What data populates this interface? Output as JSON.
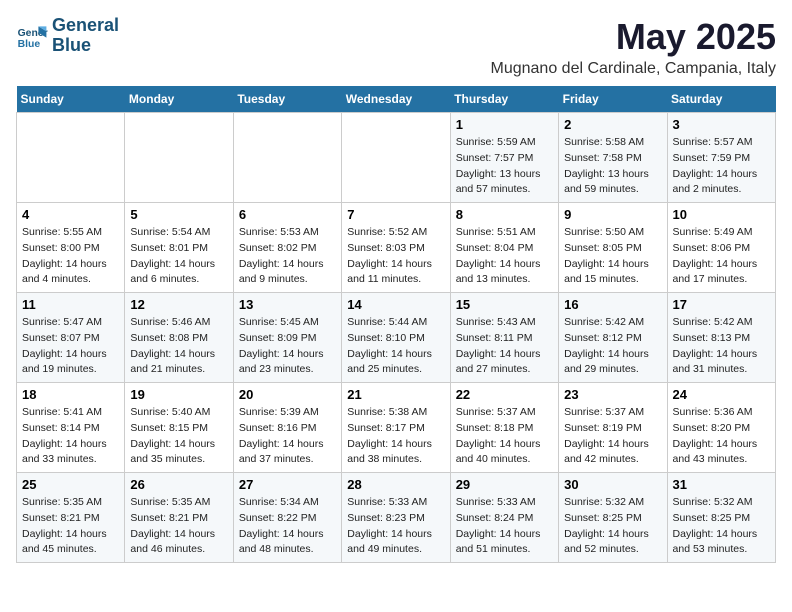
{
  "logo": {
    "line1": "General",
    "line2": "Blue"
  },
  "title": "May 2025",
  "subtitle": "Mugnano del Cardinale, Campania, Italy",
  "days_of_week": [
    "Sunday",
    "Monday",
    "Tuesday",
    "Wednesday",
    "Thursday",
    "Friday",
    "Saturday"
  ],
  "weeks": [
    [
      {
        "day": "",
        "info": ""
      },
      {
        "day": "",
        "info": ""
      },
      {
        "day": "",
        "info": ""
      },
      {
        "day": "",
        "info": ""
      },
      {
        "day": "1",
        "info": "Sunrise: 5:59 AM\nSunset: 7:57 PM\nDaylight: 13 hours\nand 57 minutes."
      },
      {
        "day": "2",
        "info": "Sunrise: 5:58 AM\nSunset: 7:58 PM\nDaylight: 13 hours\nand 59 minutes."
      },
      {
        "day": "3",
        "info": "Sunrise: 5:57 AM\nSunset: 7:59 PM\nDaylight: 14 hours\nand 2 minutes."
      }
    ],
    [
      {
        "day": "4",
        "info": "Sunrise: 5:55 AM\nSunset: 8:00 PM\nDaylight: 14 hours\nand 4 minutes."
      },
      {
        "day": "5",
        "info": "Sunrise: 5:54 AM\nSunset: 8:01 PM\nDaylight: 14 hours\nand 6 minutes."
      },
      {
        "day": "6",
        "info": "Sunrise: 5:53 AM\nSunset: 8:02 PM\nDaylight: 14 hours\nand 9 minutes."
      },
      {
        "day": "7",
        "info": "Sunrise: 5:52 AM\nSunset: 8:03 PM\nDaylight: 14 hours\nand 11 minutes."
      },
      {
        "day": "8",
        "info": "Sunrise: 5:51 AM\nSunset: 8:04 PM\nDaylight: 14 hours\nand 13 minutes."
      },
      {
        "day": "9",
        "info": "Sunrise: 5:50 AM\nSunset: 8:05 PM\nDaylight: 14 hours\nand 15 minutes."
      },
      {
        "day": "10",
        "info": "Sunrise: 5:49 AM\nSunset: 8:06 PM\nDaylight: 14 hours\nand 17 minutes."
      }
    ],
    [
      {
        "day": "11",
        "info": "Sunrise: 5:47 AM\nSunset: 8:07 PM\nDaylight: 14 hours\nand 19 minutes."
      },
      {
        "day": "12",
        "info": "Sunrise: 5:46 AM\nSunset: 8:08 PM\nDaylight: 14 hours\nand 21 minutes."
      },
      {
        "day": "13",
        "info": "Sunrise: 5:45 AM\nSunset: 8:09 PM\nDaylight: 14 hours\nand 23 minutes."
      },
      {
        "day": "14",
        "info": "Sunrise: 5:44 AM\nSunset: 8:10 PM\nDaylight: 14 hours\nand 25 minutes."
      },
      {
        "day": "15",
        "info": "Sunrise: 5:43 AM\nSunset: 8:11 PM\nDaylight: 14 hours\nand 27 minutes."
      },
      {
        "day": "16",
        "info": "Sunrise: 5:42 AM\nSunset: 8:12 PM\nDaylight: 14 hours\nand 29 minutes."
      },
      {
        "day": "17",
        "info": "Sunrise: 5:42 AM\nSunset: 8:13 PM\nDaylight: 14 hours\nand 31 minutes."
      }
    ],
    [
      {
        "day": "18",
        "info": "Sunrise: 5:41 AM\nSunset: 8:14 PM\nDaylight: 14 hours\nand 33 minutes."
      },
      {
        "day": "19",
        "info": "Sunrise: 5:40 AM\nSunset: 8:15 PM\nDaylight: 14 hours\nand 35 minutes."
      },
      {
        "day": "20",
        "info": "Sunrise: 5:39 AM\nSunset: 8:16 PM\nDaylight: 14 hours\nand 37 minutes."
      },
      {
        "day": "21",
        "info": "Sunrise: 5:38 AM\nSunset: 8:17 PM\nDaylight: 14 hours\nand 38 minutes."
      },
      {
        "day": "22",
        "info": "Sunrise: 5:37 AM\nSunset: 8:18 PM\nDaylight: 14 hours\nand 40 minutes."
      },
      {
        "day": "23",
        "info": "Sunrise: 5:37 AM\nSunset: 8:19 PM\nDaylight: 14 hours\nand 42 minutes."
      },
      {
        "day": "24",
        "info": "Sunrise: 5:36 AM\nSunset: 8:20 PM\nDaylight: 14 hours\nand 43 minutes."
      }
    ],
    [
      {
        "day": "25",
        "info": "Sunrise: 5:35 AM\nSunset: 8:21 PM\nDaylight: 14 hours\nand 45 minutes."
      },
      {
        "day": "26",
        "info": "Sunrise: 5:35 AM\nSunset: 8:21 PM\nDaylight: 14 hours\nand 46 minutes."
      },
      {
        "day": "27",
        "info": "Sunrise: 5:34 AM\nSunset: 8:22 PM\nDaylight: 14 hours\nand 48 minutes."
      },
      {
        "day": "28",
        "info": "Sunrise: 5:33 AM\nSunset: 8:23 PM\nDaylight: 14 hours\nand 49 minutes."
      },
      {
        "day": "29",
        "info": "Sunrise: 5:33 AM\nSunset: 8:24 PM\nDaylight: 14 hours\nand 51 minutes."
      },
      {
        "day": "30",
        "info": "Sunrise: 5:32 AM\nSunset: 8:25 PM\nDaylight: 14 hours\nand 52 minutes."
      },
      {
        "day": "31",
        "info": "Sunrise: 5:32 AM\nSunset: 8:25 PM\nDaylight: 14 hours\nand 53 minutes."
      }
    ]
  ]
}
